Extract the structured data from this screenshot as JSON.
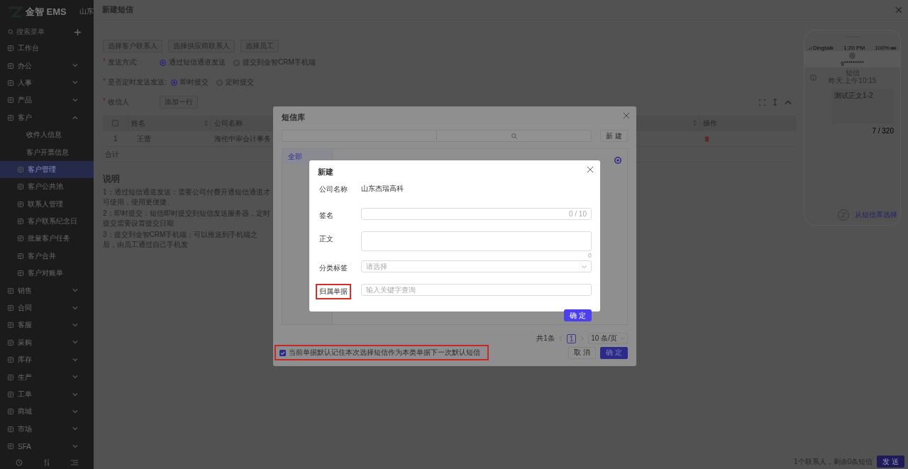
{
  "sidebar": {
    "logo": "金智 EMS",
    "header_company": "山东",
    "search_placeholder": "搜索菜单",
    "items": [
      {
        "label": "工作台",
        "kind": "link",
        "selected": false,
        "expanded": false
      },
      {
        "label": "办公",
        "kind": "group",
        "selected": false,
        "expanded": false
      },
      {
        "label": "人事",
        "kind": "group",
        "selected": false,
        "expanded": false
      },
      {
        "label": "产品",
        "kind": "group",
        "selected": false,
        "expanded": false
      },
      {
        "label": "客户",
        "kind": "group",
        "selected": false,
        "expanded": true,
        "children": [
          {
            "label": "收件人信息",
            "kind": "plain",
            "selected": false
          },
          {
            "label": "客户开票信息",
            "kind": "plain",
            "selected": false
          },
          {
            "label": "客户管理",
            "kind": "icon",
            "selected": true
          },
          {
            "label": "客户公共池",
            "kind": "icon",
            "selected": false
          },
          {
            "label": "联系人管理",
            "kind": "icon",
            "selected": false
          },
          {
            "label": "客户联系纪念日",
            "kind": "icon",
            "selected": false
          },
          {
            "label": "批量客户任务",
            "kind": "icon",
            "selected": false
          },
          {
            "label": "客户合并",
            "kind": "icon",
            "selected": false
          },
          {
            "label": "客户对账单",
            "kind": "icon",
            "selected": false
          }
        ]
      },
      {
        "label": "销售",
        "kind": "group",
        "selected": false,
        "expanded": false
      },
      {
        "label": "合同",
        "kind": "group",
        "selected": false,
        "expanded": false
      },
      {
        "label": "客服",
        "kind": "group",
        "selected": false,
        "expanded": false
      },
      {
        "label": "采购",
        "kind": "group",
        "selected": false,
        "expanded": false
      },
      {
        "label": "库存",
        "kind": "group",
        "selected": false,
        "expanded": false
      },
      {
        "label": "生产",
        "kind": "group",
        "selected": false,
        "expanded": false
      },
      {
        "label": "工单",
        "kind": "group",
        "selected": false,
        "expanded": false
      },
      {
        "label": "商城",
        "kind": "group",
        "selected": false,
        "expanded": false
      },
      {
        "label": "市场",
        "kind": "group",
        "selected": false,
        "expanded": false
      },
      {
        "label": "SFA",
        "kind": "group",
        "selected": false,
        "expanded": false
      }
    ]
  },
  "drawer": {
    "title": "新建短信",
    "pick_buttons": [
      "选择客户联系人",
      "选择供应商联系人",
      "选择员工"
    ],
    "send_mode": {
      "mark": "*",
      "label": "发送方式:",
      "options": [
        {
          "label": "通过短信通道发送",
          "selected": true
        },
        {
          "label": "提交到金智CRM手机端",
          "selected": false
        }
      ]
    },
    "timing": {
      "mark": "*",
      "label": "是否定时发送发送:",
      "options": [
        {
          "label": "即时提交",
          "selected": true
        },
        {
          "label": "定时提交",
          "selected": false
        }
      ]
    },
    "recipients": {
      "mark": "*",
      "label": "收信人",
      "add_button": "添加一行"
    },
    "table": {
      "select_all_checked": false,
      "columns": [
        "姓名",
        "公司名称"
      ],
      "action_column": "操作",
      "rows": [
        {
          "index": "1",
          "name": "王蕾",
          "company": "海伦中审会计事务"
        }
      ],
      "footer": "合计"
    },
    "notes": {
      "title": "说明",
      "lines": [
        "1：通过短信通道发送：需要公司付费开通短信通道才可使用，使用更便捷、",
        "2：即时提交：短信即时提交到短信发送服务器，定时提交需要设置提交日期",
        "3：提交到金智CRM手机端：可以推送到手机端之后，由员工通过自己手机发"
      ]
    },
    "preview": {
      "carrier": "Dingtalk",
      "time": "1:20 PM",
      "battery": "100%",
      "contact": "g*********",
      "thread_title": "短信",
      "thread_time": "昨天 上午10:15",
      "message": "测试正文1-2",
      "counter": "7 / 320",
      "pick_link": "从短信库选择"
    },
    "footer": {
      "summary": "1个联系人，剩余0条短信",
      "send_button": "发 送"
    }
  },
  "library_dialog": {
    "title": "短信库",
    "new_button": "新 建",
    "categories": [
      {
        "label": "全部",
        "selected": true
      }
    ],
    "items": [
      {
        "selected": true
      }
    ],
    "pagination": {
      "total": "共1条",
      "pages": [
        {
          "label": "1",
          "selected": true
        }
      ],
      "page_size": "10 条/页"
    },
    "remember": {
      "label": "当前单据默认记住本次选择短信作为本类单据下一次默认短信",
      "checked": true,
      "highlighted": true
    },
    "cancel_button": "取 消",
    "ok_button": "确 定"
  },
  "new_dialog": {
    "title": "新建",
    "fields": [
      {
        "kind": "static",
        "label": "公司名称",
        "value": "山东杰瑞高科",
        "highlighted": false
      },
      {
        "kind": "text",
        "label": "签名",
        "counter": "0 / 10",
        "highlighted": false
      },
      {
        "kind": "textarea",
        "label": "正文",
        "counter": "0",
        "highlighted": false
      },
      {
        "kind": "select",
        "label": "分类标签",
        "placeholder": "请选择",
        "highlighted": false
      },
      {
        "kind": "search",
        "label": "归属单据",
        "placeholder": "输入关键字查询",
        "highlighted": true
      }
    ],
    "ok_button": "确 定"
  }
}
